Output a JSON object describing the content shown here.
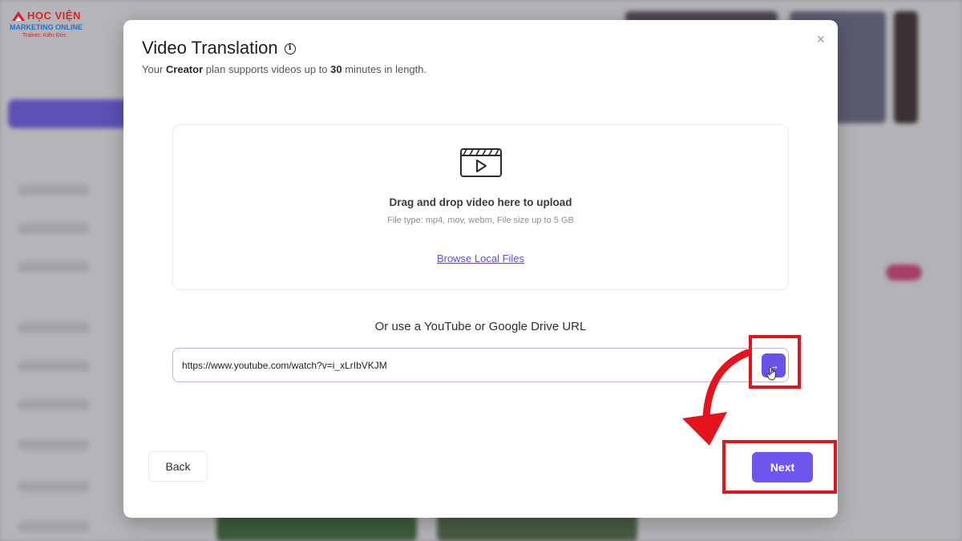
{
  "modal": {
    "title": "Video Translation",
    "subtitle_prefix": "Your ",
    "plan_name": "Creator",
    "subtitle_middle": " plan supports videos up to ",
    "limit_minutes": "30",
    "subtitle_suffix": " minutes in length.",
    "close_symbol": "×"
  },
  "upload": {
    "title": "Drag and drop video here to upload",
    "file_info": "File type: mp4, mov, webm, File size up to 5 GB",
    "browse_label": "Browse Local Files"
  },
  "url": {
    "heading": "Or use a YouTube or Google Drive URL",
    "value": "https://www.youtube.com/watch?v=i_xLrIbVKJM",
    "submit_symbol": "→"
  },
  "footer": {
    "back_label": "Back",
    "next_label": "Next"
  },
  "logo": {
    "line1": "HỌC VIỆN",
    "line2": "MARKETING ONLINE",
    "line3": "Trainer: Kiên Đức"
  },
  "colors": {
    "accent": "#6e57ee",
    "highlight": "#e3141b",
    "link": "#5b4ee0"
  },
  "icons": [
    "info-icon",
    "close-icon",
    "video-clapper-icon",
    "arrow-right-icon",
    "hand-cursor-icon",
    "curved-arrow-icon"
  ]
}
